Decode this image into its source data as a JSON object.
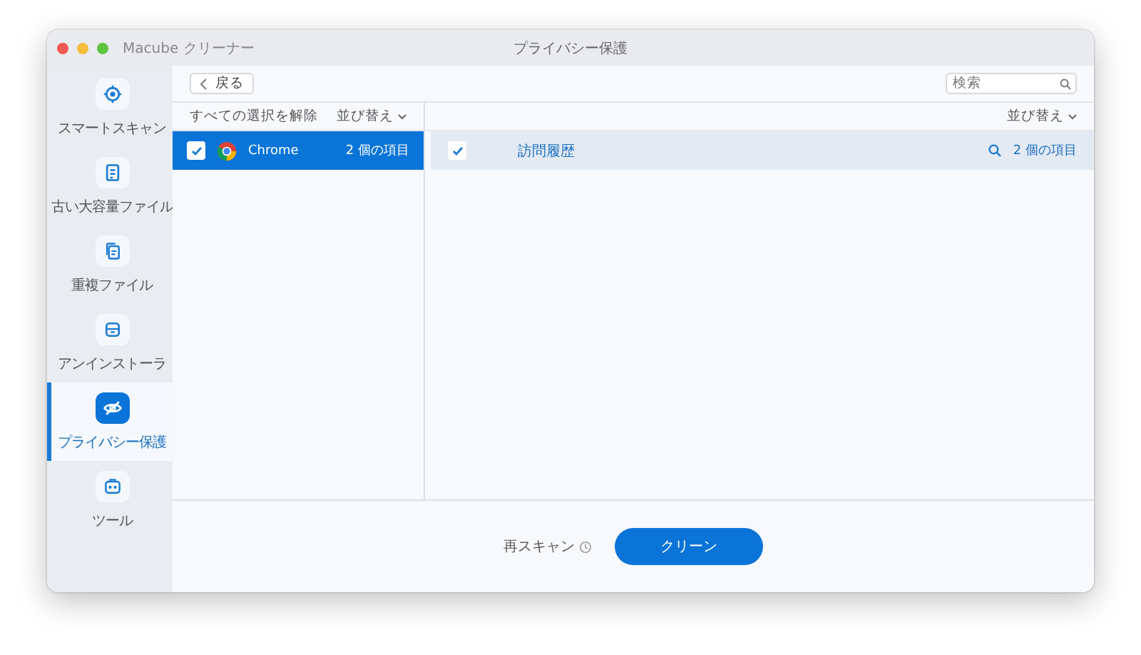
{
  "window": {
    "title": "Macube クリーナー",
    "section_title": "プライバシー保護"
  },
  "sidebar": {
    "items": [
      {
        "label": "スマートスキャン",
        "selected": false
      },
      {
        "label": "古い大容量ファイル",
        "selected": false
      },
      {
        "label": "重複ファイル",
        "selected": false
      },
      {
        "label": "アンインストーラ",
        "selected": false
      },
      {
        "label": "プライバシー保護",
        "selected": true
      },
      {
        "label": "ツール",
        "selected": false
      }
    ]
  },
  "toolbar": {
    "back": "戻る",
    "search": {
      "placeholder": "検索"
    }
  },
  "left_panel": {
    "deselect_all": "すべての選択を解除",
    "sort": "並び替え",
    "items": [
      {
        "name": "Chrome",
        "count": "2 個の項目",
        "checked": true,
        "selected": true
      }
    ]
  },
  "right_panel": {
    "sort": "並び替え",
    "items": [
      {
        "name": "訪問履歴",
        "count": "2 個の項目",
        "checked": true,
        "selected": true
      }
    ]
  },
  "footer": {
    "rescan": "再スキャン",
    "clean": "クリーン"
  }
}
